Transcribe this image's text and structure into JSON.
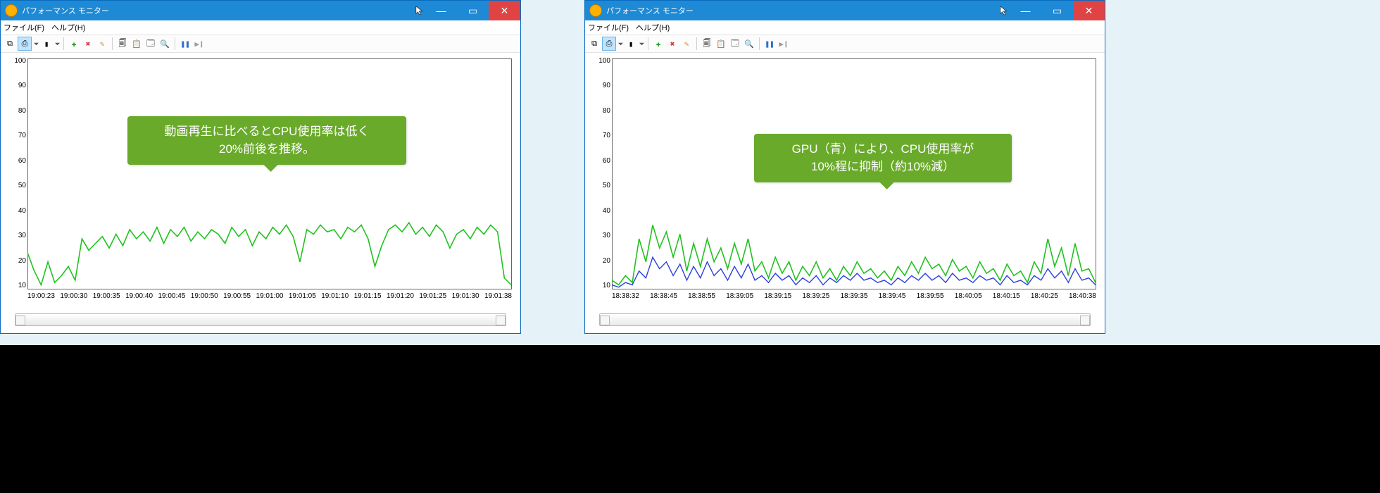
{
  "windows": {
    "a": {
      "title": "パフォーマンス モニター",
      "menu": {
        "file": "ファイル(F)",
        "help": "ヘルプ(H)"
      },
      "callout": "動画再生に比べるとCPU使用率は低く\n20%前後を推移。"
    },
    "b": {
      "title": "パフォーマンス モニター",
      "menu": {
        "file": "ファイル(F)",
        "help": "ヘルプ(H)"
      },
      "callout": "GPU（青）により、CPU使用率が\n10%程に抑制（約10%減）"
    }
  },
  "winbtn": {
    "min": "—",
    "max": "▭",
    "close": "✕"
  },
  "toolbar": {
    "counter_group": "⧉",
    "view_type": "⎙",
    "view_dd": "▾",
    "props": "▮",
    "props_dd": "▾",
    "add": "✚",
    "del": "✖",
    "highlight": "✎",
    "copy": "🗐",
    "paste": "📋",
    "options": "🗔",
    "zoom": "🔍",
    "pause": "❚❚",
    "step": "▶❙"
  },
  "y_ticks": [
    "100",
    "90",
    "80",
    "70",
    "60",
    "50",
    "40",
    "30",
    "20",
    "10"
  ],
  "chart_data": [
    {
      "id": "a",
      "type": "line",
      "title": "",
      "xlabel": "",
      "ylabel": "",
      "ylim": [
        0,
        100
      ],
      "x_ticks": [
        "19:00:23",
        "19:00:30",
        "19:00:35",
        "19:00:40",
        "19:00:45",
        "19:00:50",
        "19:00:55",
        "19:01:00",
        "19:01:05",
        "19:01:10",
        "19:01:15",
        "19:01:20",
        "19:01:25",
        "19:01:30",
        "19:01:38"
      ],
      "series": [
        {
          "name": "CPU",
          "color": "#21c21f",
          "values": [
            16,
            8,
            2,
            12,
            3,
            6,
            10,
            4,
            22,
            17,
            20,
            23,
            18,
            24,
            19,
            26,
            22,
            25,
            21,
            27,
            20,
            26,
            23,
            27,
            21,
            25,
            22,
            26,
            24,
            20,
            27,
            23,
            26,
            19,
            25,
            22,
            27,
            24,
            28,
            23,
            12,
            26,
            24,
            28,
            25,
            26,
            22,
            27,
            25,
            28,
            22,
            10,
            19,
            26,
            28,
            25,
            29,
            24,
            27,
            23,
            28,
            25,
            18,
            24,
            26,
            22,
            27,
            24,
            28,
            25,
            5,
            2
          ]
        }
      ]
    },
    {
      "id": "b",
      "type": "line",
      "title": "",
      "xlabel": "",
      "ylabel": "",
      "ylim": [
        0,
        100
      ],
      "x_ticks": [
        "18:38:32",
        "18:38:45",
        "18:38:55",
        "18:39:05",
        "18:39:15",
        "18:39:25",
        "18:39:35",
        "18:39:45",
        "18:39:55",
        "18:40:05",
        "18:40:15",
        "18:40:25",
        "18:40:38"
      ],
      "series": [
        {
          "name": "CPU",
          "color": "#21c21f",
          "values": [
            4,
            2,
            6,
            3,
            22,
            12,
            28,
            18,
            25,
            14,
            24,
            8,
            20,
            10,
            22,
            12,
            18,
            9,
            20,
            11,
            22,
            8,
            12,
            5,
            14,
            7,
            12,
            4,
            10,
            6,
            12,
            5,
            9,
            4,
            10,
            6,
            12,
            7,
            9,
            5,
            8,
            4,
            10,
            6,
            12,
            7,
            14,
            9,
            11,
            6,
            13,
            8,
            10,
            5,
            12,
            7,
            9,
            4,
            11,
            6,
            8,
            3,
            12,
            7,
            22,
            10,
            18,
            6,
            20,
            8,
            9,
            3
          ]
        },
        {
          "name": "GPU",
          "color": "#2a3fe0",
          "values": [
            2,
            1,
            3,
            2,
            8,
            5,
            14,
            9,
            12,
            6,
            11,
            4,
            10,
            5,
            12,
            6,
            9,
            4,
            10,
            5,
            11,
            4,
            6,
            3,
            7,
            4,
            6,
            2,
            5,
            3,
            6,
            2,
            5,
            3,
            6,
            4,
            7,
            4,
            5,
            3,
            4,
            2,
            5,
            3,
            6,
            4,
            7,
            4,
            6,
            3,
            7,
            4,
            5,
            3,
            6,
            4,
            5,
            2,
            6,
            3,
            4,
            2,
            6,
            4,
            9,
            5,
            8,
            3,
            9,
            4,
            5,
            2
          ]
        }
      ]
    }
  ]
}
